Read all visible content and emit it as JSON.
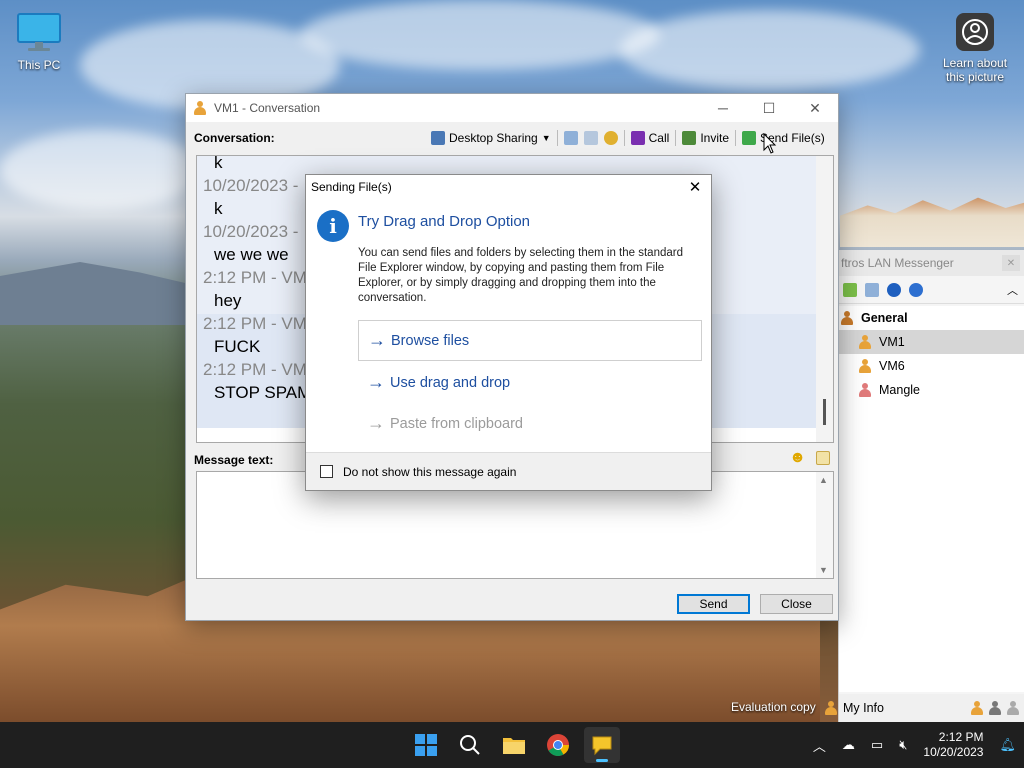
{
  "desktop": {
    "icons": [
      {
        "label": "This PC"
      },
      {
        "label": "Learn about this picture"
      }
    ],
    "evaluation_text": "Evaluation copy"
  },
  "conversation_window": {
    "title": "VM1 - Conversation",
    "conversation_label": "Conversation:",
    "toolbar": {
      "desktop_sharing": "Desktop Sharing",
      "call": "Call",
      "invite": "Invite",
      "send_files": "Send File(s)"
    },
    "messages": [
      {
        "kind": "body",
        "text": "k"
      },
      {
        "kind": "ts",
        "text": "10/20/2023 -"
      },
      {
        "kind": "body",
        "text": "k"
      },
      {
        "kind": "ts",
        "text": "10/20/2023 -"
      },
      {
        "kind": "body",
        "text": "we we we"
      },
      {
        "kind": "ts",
        "text": "2:12 PM - VM"
      },
      {
        "kind": "body",
        "text": "hey"
      },
      {
        "kind": "ts",
        "text": "2:12 PM - VM"
      },
      {
        "kind": "body",
        "text": "FUCK"
      },
      {
        "kind": "ts",
        "text": "2:12 PM - VM"
      },
      {
        "kind": "body",
        "text": "STOP SPAM"
      }
    ],
    "message_text_label": "Message text:",
    "message_value": "",
    "send_label": "Send",
    "close_label": "Close"
  },
  "dialog": {
    "title": "Sending File(s)",
    "heading": "Try Drag and Drop Option",
    "body": "You can send files and folders by selecting them in the standard File Explorer window, by copying and pasting them from File Explorer, or by simply dragging and dropping them into the conversation.",
    "options": [
      {
        "label": "Browse files",
        "state": "selected"
      },
      {
        "label": "Use drag and drop",
        "state": "enabled"
      },
      {
        "label": "Paste from clipboard",
        "state": "disabled"
      }
    ],
    "checkbox_label": "Do not show this message again",
    "checkbox_checked": false
  },
  "messenger": {
    "title": "ftros LAN Messenger",
    "group": "General",
    "contacts": [
      {
        "name": "VM1",
        "color": "#e8a33a",
        "selected": true
      },
      {
        "name": "VM6",
        "color": "#e8a33a",
        "selected": false
      },
      {
        "name": "Mangle",
        "color": "#e07a7a",
        "selected": false
      }
    ],
    "status_label": "My Info"
  },
  "taskbar": {
    "time": "2:12 PM",
    "date": "10/20/2023"
  },
  "colors": {
    "accent": "#0078d4",
    "link_blue": "#1e4fa0",
    "info_blue": "#1a6fc6"
  }
}
